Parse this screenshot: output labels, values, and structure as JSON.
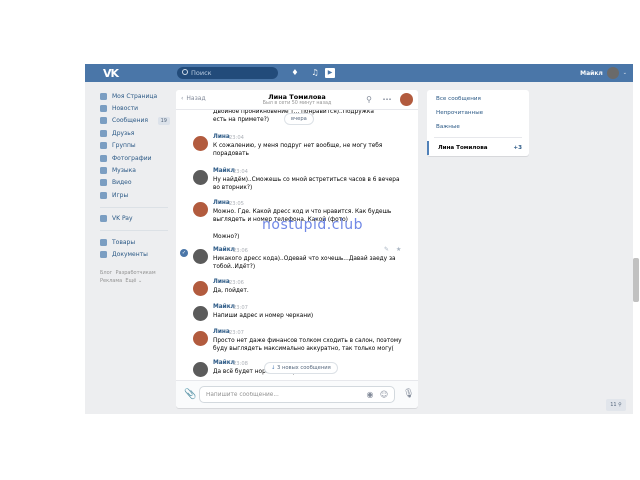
{
  "topbar": {
    "logo": "VK",
    "search_placeholder": "Поиск",
    "user_name": "Майкл",
    "icons": [
      "bell-icon",
      "music-icon",
      "play-icon"
    ]
  },
  "sidebar": {
    "items": [
      {
        "label": "Моя Страница",
        "icon": "home-icon"
      },
      {
        "label": "Новости",
        "icon": "news-icon"
      },
      {
        "label": "Сообщения",
        "icon": "message-icon",
        "count": "19"
      },
      {
        "label": "Друзья",
        "icon": "friends-icon"
      },
      {
        "label": "Группы",
        "icon": "groups-icon"
      },
      {
        "label": "Фотографии",
        "icon": "photo-icon"
      },
      {
        "label": "Музыка",
        "icon": "music-icon"
      },
      {
        "label": "Видео",
        "icon": "video-icon"
      },
      {
        "label": "Игры",
        "icon": "games-icon"
      }
    ],
    "items2": [
      {
        "label": "VK Pay",
        "icon": "vkpay-icon"
      }
    ],
    "items3": [
      {
        "label": "Товары",
        "icon": "goods-icon"
      },
      {
        "label": "Документы",
        "icon": "docs-icon"
      }
    ],
    "footer": {
      "blog": "Блог",
      "devs": "Разработчикам",
      "ads": "Реклама",
      "more": "Ещё ⌄"
    }
  },
  "chat": {
    "back_label": "Назад",
    "name": "Лина Томилова",
    "status": "Был в сети 50 минут назад",
    "date_pill": "вчера",
    "new_messages_pill": "3 новых сообщения",
    "compose_placeholder": "Напишите сообщение...",
    "messages": [
      {
        "author": "",
        "time": "",
        "text": "Двойное проникновение т... понравится)..Подружка\nесть на примете?)"
      },
      {
        "author": "Лина",
        "time": "23:04",
        "text": "К сожалению, у меня подруг нет вообще, не могу тебя\nпорадовать"
      },
      {
        "author": "Майкл",
        "time": "23:04",
        "text": "Ну найдём)..Сможешь со мной встретиться часов в 6 вечера\nво вторник?)"
      },
      {
        "author": "Лина",
        "time": "23:05",
        "text": "Можно. Где. Какой дресс код и что нравится. Как будешь\nвыглядеть и номер телефона. Какой (фото)\n\nМожно?)"
      },
      {
        "author": "Майкл",
        "time": "23:06",
        "text": "Никакого дресс кода)..Одевай что хочешь...Давай заеду за\nтобой..Идёт?)"
      },
      {
        "author": "Лина",
        "time": "23:06",
        "text": "Да, пойдет."
      },
      {
        "author": "Майкл",
        "time": "23:07",
        "text": "Напиши адрес и номер черкани)"
      },
      {
        "author": "Лина",
        "time": "23:07",
        "text": "Просто нет даже финансов толком сходить в салон, поэтому\nбуду выглядеть максимально аккуратно, так только могу("
      },
      {
        "author": "Майкл",
        "time": "23:08",
        "text": "Да всё будет норм...Не переживай)"
      }
    ]
  },
  "right_panel": {
    "all": "Все сообщения",
    "unread": "Непрочитанные",
    "important": "Важные",
    "active_name": "Лина Томилова",
    "active_count": "+3"
  },
  "corner_badge": "11 ⚲",
  "watermark": "nostupid.club",
  "colors": {
    "header": "#4a76a8",
    "link": "#2a5885",
    "bg": "#edeef0"
  }
}
